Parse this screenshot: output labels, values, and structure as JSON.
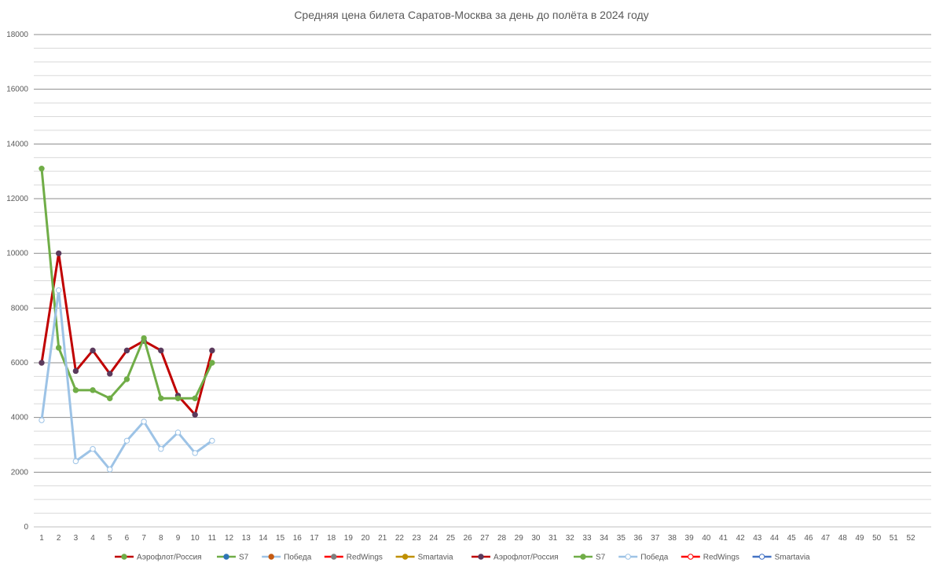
{
  "chart_data": {
    "type": "line",
    "title": "Средняя цена билета Саратов-Москва за день до полёта в 2024 году",
    "xlabel": "",
    "ylabel": "",
    "ylim": [
      0,
      18000
    ],
    "y_ticks": [
      0,
      2000,
      4000,
      6000,
      8000,
      10000,
      12000,
      14000,
      16000,
      18000
    ],
    "y_minor_step": 500,
    "x": [
      1,
      2,
      3,
      4,
      5,
      6,
      7,
      8,
      9,
      10,
      11,
      12,
      13,
      14,
      15,
      16,
      17,
      18,
      19,
      20,
      21,
      22,
      23,
      24,
      25,
      26,
      27,
      28,
      29,
      30,
      31,
      32,
      33,
      34,
      35,
      36,
      37,
      38,
      39,
      40,
      41,
      42,
      43,
      44,
      45,
      46,
      47,
      48,
      49,
      50,
      51,
      52
    ],
    "grid": true,
    "legend_position": "bottom",
    "series": [
      {
        "name": "Аэрофлот/Россия",
        "color": "#C00000",
        "marker_fill": "#70AD47",
        "marker_stroke": "#70AD47",
        "values": []
      },
      {
        "name": "S7",
        "color": "#70AD47",
        "marker_fill": "#2E75B6",
        "marker_stroke": "#2E75B6",
        "values": []
      },
      {
        "name": "Победа",
        "color": "#9DC3E6",
        "marker_fill": "#C55A11",
        "marker_stroke": "#C55A11",
        "values": []
      },
      {
        "name": "RedWings",
        "color": "#FF0000",
        "marker_fill": "#7F7F7F",
        "marker_stroke": "#7F7F7F",
        "values": []
      },
      {
        "name": "Smartavia",
        "color": "#BF9000",
        "marker_fill": "#BF9000",
        "marker_stroke": "#BF9000",
        "values": []
      },
      {
        "name": "Аэрофлот/Россия",
        "color": "#C00000",
        "marker_fill": "#5B3A5C",
        "marker_stroke": "#5B3A5C",
        "values": [
          6000,
          10000,
          5700,
          6450,
          5600,
          6450,
          6800,
          6450,
          4800,
          4100,
          6450
        ]
      },
      {
        "name": "S7",
        "color": "#70AD47",
        "marker_fill": "#70AD47",
        "marker_stroke": "#70AD47",
        "values": [
          13100,
          6550,
          5000,
          5000,
          4700,
          5400,
          6900,
          4700,
          4700,
          4700,
          6000
        ]
      },
      {
        "name": "Победа",
        "color": "#9DC3E6",
        "marker_fill": "#FFFFFF",
        "marker_stroke": "#9DC3E6",
        "values": [
          3900,
          8650,
          2400,
          2850,
          2100,
          3150,
          3850,
          2850,
          3450,
          2700,
          3150
        ]
      },
      {
        "name": "RedWings",
        "color": "#FF0000",
        "marker_fill": "#FFFFFF",
        "marker_stroke": "#FF0000",
        "values": []
      },
      {
        "name": "Smartavia",
        "color": "#4472C4",
        "marker_fill": "#FFFFFF",
        "marker_stroke": "#4472C4",
        "values": []
      }
    ]
  }
}
